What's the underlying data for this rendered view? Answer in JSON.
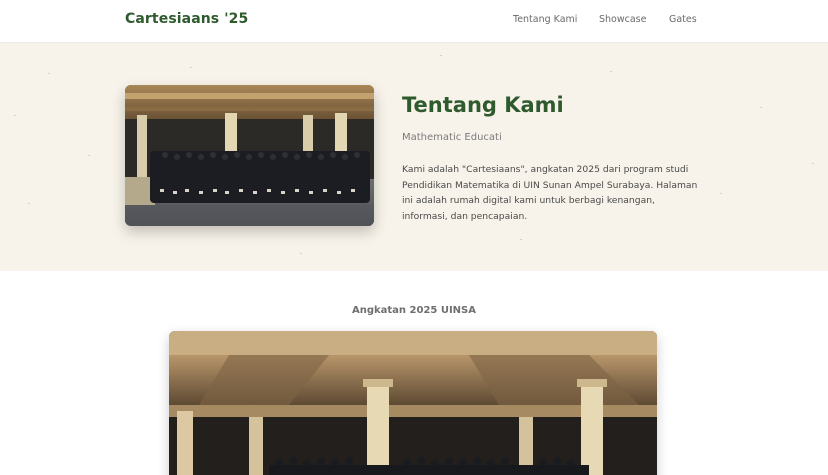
{
  "nav": {
    "brand": "Cartesiaans '25",
    "links": [
      "Tentang Kami",
      "Showcase",
      "Gates"
    ]
  },
  "about": {
    "title": "Tentang Kami",
    "subtitle": "Mathematic Educati",
    "body": "Kami adalah \"Cartesiaans\", angkatan 2025 dari program studi Pendidikan Matematika di UIN Sunan Ampel Surabaya. Halaman ini adalah rumah digital kami untuk berbagi kenangan, informasi, dan pencapaian."
  },
  "gallery": {
    "heading": "Angkatan 2025 UINSA"
  },
  "colors": {
    "brand_green": "#2e5a2e",
    "about_bg": "#f7f3ea"
  }
}
